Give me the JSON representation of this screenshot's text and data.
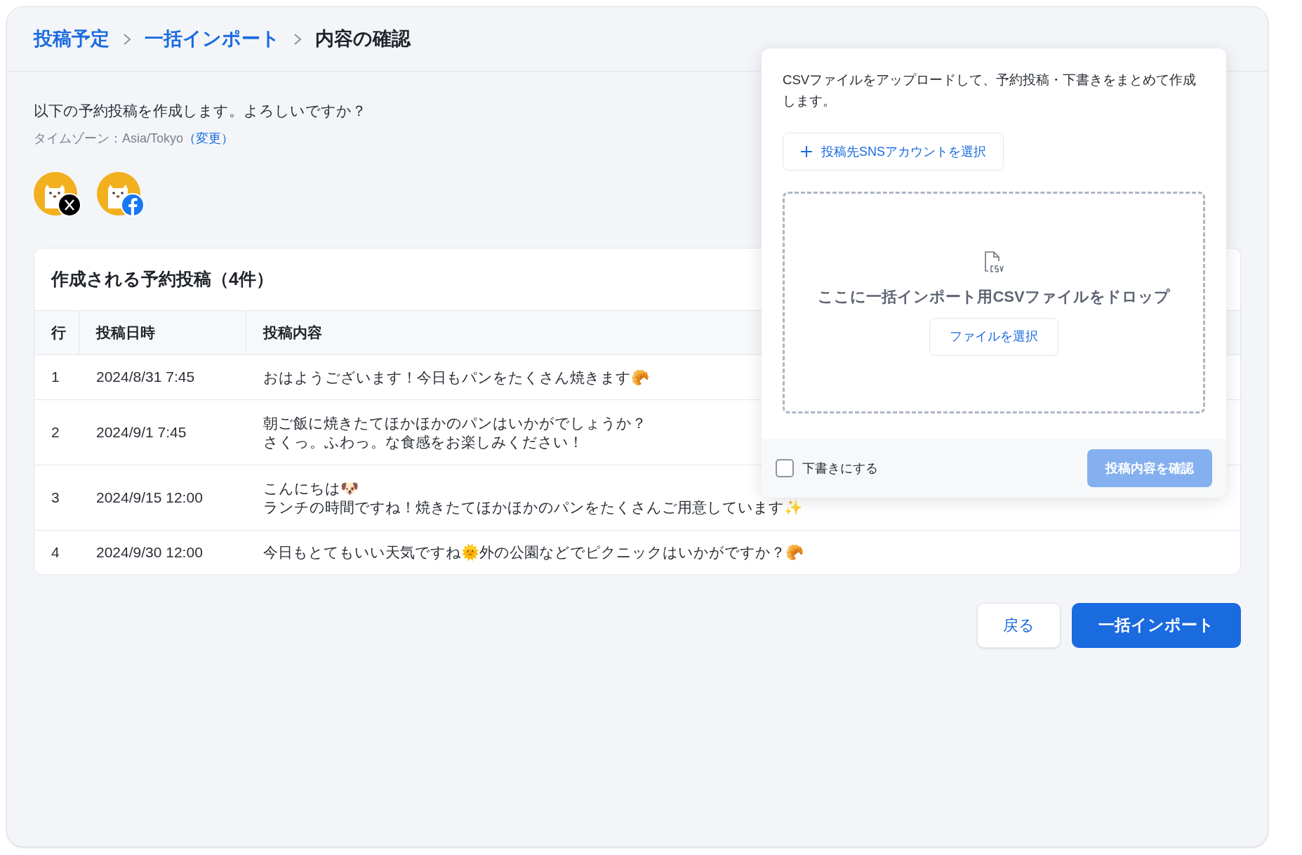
{
  "breadcrumb": [
    {
      "label": "投稿予定",
      "kind": "link"
    },
    {
      "label": "一括インポート",
      "kind": "link"
    },
    {
      "label": "内容の確認",
      "kind": "current"
    }
  ],
  "intro": {
    "message": "以下の予約投稿を作成します。よろしいですか？",
    "timezone_label": "タイムゾーン：Asia/Tokyo",
    "timezone_link": "（変更）"
  },
  "accounts": [
    {
      "kind": "x"
    },
    {
      "kind": "facebook"
    }
  ],
  "table": {
    "title": "作成される予約投稿（4件）",
    "columns": [
      "行",
      "投稿日時",
      "投稿内容"
    ],
    "rows": [
      {
        "row": "1",
        "datetime": "2024/8/31 7:45",
        "content": [
          "おはようございます！今日もパンをたくさん焼きます🥐"
        ]
      },
      {
        "row": "2",
        "datetime": "2024/9/1 7:45",
        "content": [
          "朝ご飯に焼きたてほかほかのパンはいかがでしょうか？",
          "さくっ。ふわっ。な食感をお楽しみください！"
        ]
      },
      {
        "row": "3",
        "datetime": "2024/9/15 12:00",
        "content": [
          "こんにちは🐶",
          "ランチの時間ですね！焼きたてほかほかのパンをたくさんご用意しています✨"
        ]
      },
      {
        "row": "4",
        "datetime": "2024/9/30 12:00",
        "content": [
          "今日もとてもいい天気ですね🌞外の公園などでピクニックはいかがですか？🥐"
        ]
      }
    ]
  },
  "popover": {
    "description": "CSVファイルをアップロードして、予約投稿・下書きをまとめて作成します。",
    "account_button": "投稿先SNSアカウントを選択",
    "dropzone_text": "ここに一括インポート用CSVファイルをドロップ",
    "file_button": "ファイルを選択",
    "draft": {
      "label": "下書きにする",
      "checked": false
    },
    "confirm_button": {
      "label": "投稿内容を確認",
      "disabled": true
    }
  },
  "actions": {
    "back": "戻る",
    "import": "一括インポート"
  }
}
